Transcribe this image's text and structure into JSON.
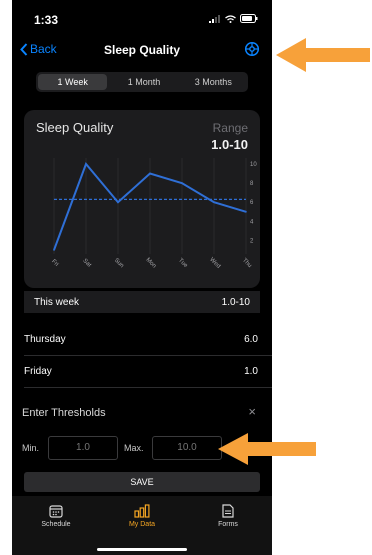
{
  "status": {
    "time": "1:33"
  },
  "nav": {
    "back_label": "Back",
    "title": "Sleep Quality"
  },
  "segments": [
    "1 Week",
    "1 Month",
    "3 Months"
  ],
  "card": {
    "title": "Sleep Quality",
    "range_label": "Range",
    "range_value": "1.0-10"
  },
  "chart_data": {
    "type": "line",
    "title": "Sleep Quality",
    "categories": [
      "Fri",
      "Sat",
      "Sun",
      "Mon",
      "Tue",
      "Wed",
      "Thu"
    ],
    "values": [
      1.0,
      10.0,
      6.0,
      9.0,
      8.0,
      6.0,
      5.0
    ],
    "threshold": 6.3,
    "ylim": [
      1,
      10
    ],
    "yticks": [
      2,
      4,
      6,
      8,
      10
    ],
    "line_color": "#2f6fd6",
    "threshold_style": "dashed"
  },
  "summary": {
    "label": "This week",
    "value": "1.0-10"
  },
  "days": [
    {
      "label": "Thursday",
      "value": "6.0"
    },
    {
      "label": "Friday",
      "value": "1.0"
    }
  ],
  "thresholds": {
    "title": "Enter Thresholds",
    "close_glyph": "×",
    "min_label": "Min.",
    "min_placeholder": "1.0",
    "max_label": "Max.",
    "max_placeholder": "10.0",
    "save_label": "SAVE"
  },
  "tabs": [
    {
      "label": "Schedule",
      "icon": "calendar-icon"
    },
    {
      "label": "My Data",
      "icon": "bar-chart-icon"
    },
    {
      "label": "Forms",
      "icon": "document-icon"
    }
  ],
  "colors": {
    "accent": "#0a84ff",
    "tab_active": "#f5a623",
    "arrow": "#f7a13a"
  }
}
